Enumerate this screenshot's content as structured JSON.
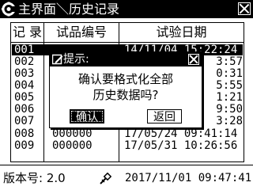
{
  "title_bar": {
    "logo_icon": "gear-c-logo-icon",
    "title": "主界面＼历史记录",
    "close_icon": "close-icon"
  },
  "table": {
    "headers": {
      "no": "记 录",
      "code": "试品编号",
      "date": "试验日期"
    },
    "rows": [
      {
        "no": "001",
        "code": "",
        "date": "14/11/04 15:22:24",
        "selected": true
      },
      {
        "no": "002",
        "code": "",
        "date": "3:57"
      },
      {
        "no": "003",
        "code": "",
        "date": "0:31"
      },
      {
        "no": "004",
        "code": "",
        "date": "5:55"
      },
      {
        "no": "005",
        "code": "",
        "date": "1:21"
      },
      {
        "no": "006",
        "code": "",
        "date": "9:50"
      },
      {
        "no": "007",
        "code": "",
        "date": "3:28"
      },
      {
        "no": "008",
        "code": "000000",
        "date": "17/05/24 09:41:14"
      },
      {
        "no": "009",
        "code": "000000",
        "date": "17/05/31 10:26:56"
      }
    ]
  },
  "dialog": {
    "title_icon": "edit-icon",
    "title": "提示:",
    "message_line1": "确认要格式化全部",
    "message_line2": "历史数据吗?",
    "confirm_label": "确认",
    "back_label": "返回"
  },
  "status_bar": {
    "version": "版本号: 2.0",
    "usb_icon": "usb-icon",
    "datetime": "2017/11/01 09:47:41"
  }
}
